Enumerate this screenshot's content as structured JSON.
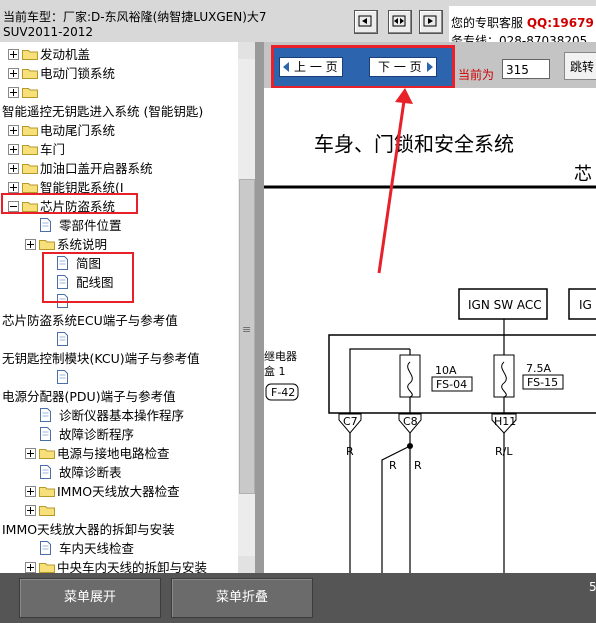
{
  "header": {
    "car_line1": "当前车型：厂家:D-东风裕隆(纳智捷LUXGEN)大7",
    "car_line2": "SUV2011-2012",
    "service_label": "您的专职客服",
    "qq": "QQ:19679",
    "hotline": "务专线：028-87038205",
    "nav_icons": [
      "prev-arrow-icon",
      "expand-arrows-icon",
      "next-arrow-icon"
    ]
  },
  "tree": {
    "items": [
      {
        "label": "发动机盖",
        "type": "folder",
        "expander": "plus"
      },
      {
        "label": "电动门锁系统",
        "type": "folder",
        "expander": "plus"
      },
      {
        "label": "",
        "type": "folder",
        "expander": "plus"
      },
      {
        "label": "智能遥控无钥匙进入系统 (智能钥匙)",
        "type": "text"
      },
      {
        "label": "电动尾门系统",
        "type": "folder",
        "expander": "plus"
      },
      {
        "label": "车门",
        "type": "folder",
        "expander": "plus"
      },
      {
        "label": "加油口盖开启器系统",
        "type": "folder",
        "expander": "plus"
      },
      {
        "label": "智能钥匙系统(I",
        "type": "folder",
        "expander": "plus"
      },
      {
        "label": "芯片防盗系统",
        "type": "folder",
        "expander": "minus"
      },
      {
        "label": "零部件位置",
        "type": "page"
      },
      {
        "label": "系统说明",
        "type": "folder",
        "expander": "plus"
      },
      {
        "label": "简图",
        "type": "page"
      },
      {
        "label": "配线图",
        "type": "page"
      },
      {
        "label": "",
        "type": "page"
      },
      {
        "label": "芯片防盗系统ECU端子与参考值",
        "type": "text"
      },
      {
        "label": "",
        "type": "page"
      },
      {
        "label": "无钥匙控制模块(KCU)端子与参考值",
        "type": "text"
      },
      {
        "label": "",
        "type": "page"
      },
      {
        "label": "电源分配器(PDU)端子与参考值",
        "type": "text"
      },
      {
        "label": "诊断仪器基本操作程序",
        "type": "page"
      },
      {
        "label": "故障诊断程序",
        "type": "page"
      },
      {
        "label": "电源与接地电路检查",
        "type": "folder",
        "expander": "plus"
      },
      {
        "label": "故障诊断表",
        "type": "page"
      },
      {
        "label": "IMMO天线放大器检查",
        "type": "folder",
        "expander": "plus"
      },
      {
        "label": "",
        "type": "folder",
        "expander": "plus"
      },
      {
        "label": "IMMO天线放大器的拆卸与安装",
        "type": "text"
      },
      {
        "label": "车内天线检查",
        "type": "page"
      },
      {
        "label": "中央车内天线的拆卸与安装",
        "type": "folder",
        "expander": "plus"
      }
    ]
  },
  "pager": {
    "prev_label": "上 一 页",
    "next_label": "下 一 页",
    "current_label": "当前为",
    "current_value": "315",
    "jump_label": "跳转"
  },
  "diagram": {
    "title": "车身、门锁和安全系统",
    "title_right": "芯",
    "ign_box1": "IGN SW ACC",
    "ign_box2": "IG",
    "relay_line1": "继电器",
    "relay_line2": "盒 1",
    "relay_conn": "F-42",
    "fuse1_amp": "10A",
    "fuse1_code": "FS-04",
    "fuse2_amp": "7.5A",
    "fuse2_code": "FS-15",
    "pin_c7": "C7",
    "pin_c8": "C8",
    "pin_h11": "H11",
    "wire_r1": "R",
    "wire_r2": "R",
    "wire_r3": "R",
    "wire_rl": "R/L"
  },
  "footer": {
    "expand_label": "菜单展开",
    "collapse_label": "菜单折叠",
    "edge_digit": "5"
  },
  "colors": {
    "annotation_red": "#e8202a",
    "pager_blue": "#2c64ad",
    "qq_red": "#d00000"
  }
}
